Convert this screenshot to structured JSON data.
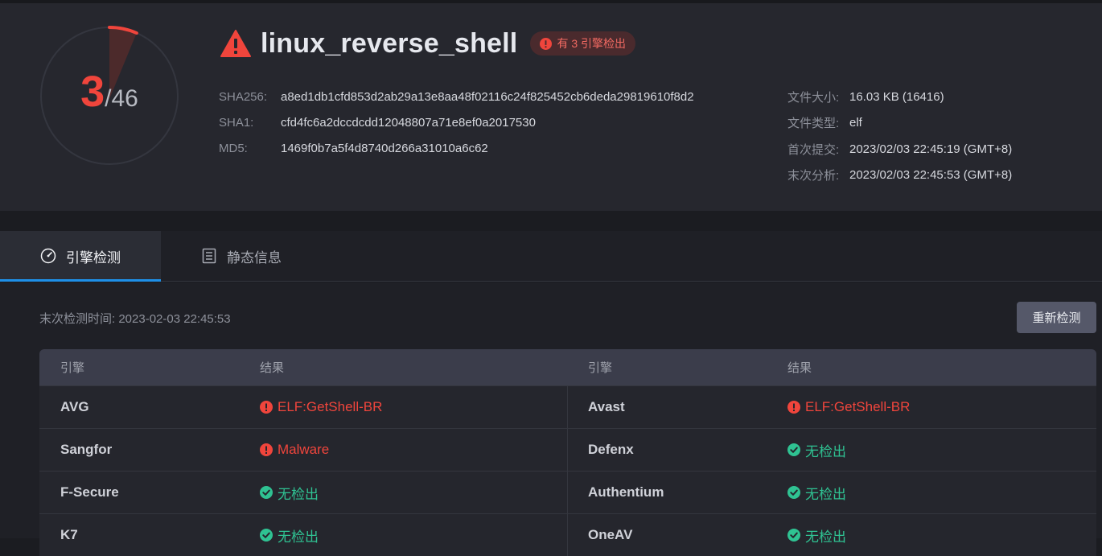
{
  "score": {
    "detected": "3",
    "total": "/46"
  },
  "header": {
    "file_name": "linux_reverse_shell",
    "badge": "有 3 引擎检出",
    "hashes": [
      {
        "key": "SHA256:",
        "value": "a8ed1db1cfd853d2ab29a13e8aa48f02116c24f825452cb6deda29819610f8d2"
      },
      {
        "key": "SHA1:",
        "value": "cfd4fc6a2dccdcdd12048807a71e8ef0a2017530"
      },
      {
        "key": "MD5:",
        "value": "1469f0b7a5f4d8740d266a31010a6c62"
      }
    ],
    "meta": [
      {
        "key": "文件大小:",
        "value": "16.03 KB (16416)"
      },
      {
        "key": "文件类型:",
        "value": "elf"
      },
      {
        "key": "首次提交:",
        "value": "2023/02/03 22:45:19 (GMT+8)"
      },
      {
        "key": "末次分析:",
        "value": "2023/02/03 22:45:53 (GMT+8)"
      }
    ]
  },
  "tabs": [
    {
      "label": "引擎检测",
      "icon": "gauge-icon",
      "active": true
    },
    {
      "label": "静态信息",
      "icon": "document-icon",
      "active": false
    }
  ],
  "scan": {
    "last_check": "末次检测时间: 2023-02-03 22:45:53",
    "rescan_label": "重新检测"
  },
  "table": {
    "headers": [
      "引擎",
      "结果",
      "引擎",
      "结果"
    ],
    "rows": [
      {
        "engine1": "AVG",
        "result1": "ELF:GetShell-BR",
        "status1": "detected",
        "engine2": "Avast",
        "result2": "ELF:GetShell-BR",
        "status2": "detected"
      },
      {
        "engine1": "Sangfor",
        "result1": "Malware",
        "status1": "detected",
        "engine2": "Defenx",
        "result2": "无检出",
        "status2": "clean"
      },
      {
        "engine1": "F-Secure",
        "result1": "无检出",
        "status1": "clean",
        "engine2": "Authentium",
        "result2": "无检出",
        "status2": "clean"
      },
      {
        "engine1": "K7",
        "result1": "无检出",
        "status1": "clean",
        "engine2": "OneAV",
        "result2": "无检出",
        "status2": "clean"
      }
    ]
  },
  "colors": {
    "danger": "#f0453c",
    "ok": "#2fc292",
    "accent": "#1e90e8"
  }
}
